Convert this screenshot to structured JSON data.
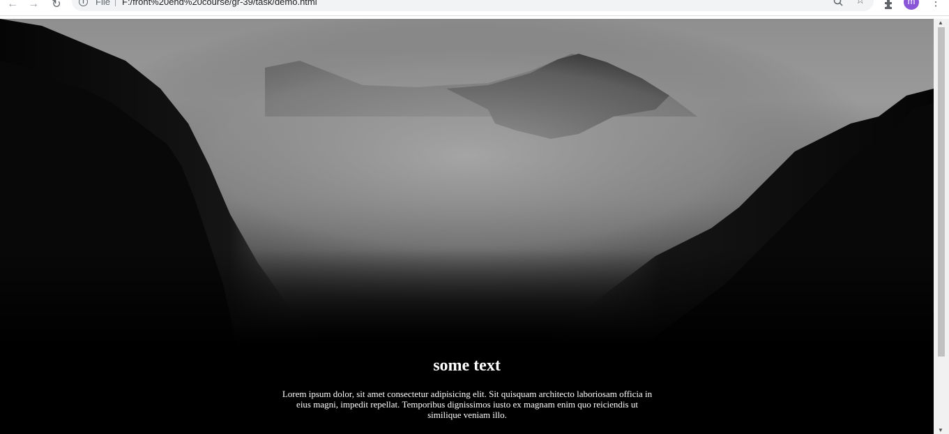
{
  "browser": {
    "scheme_label": "File",
    "url": "F:/front%20end%20course/gr-39/task/demo.html",
    "avatar_letter": "m"
  },
  "page": {
    "heading": "some text",
    "paragraph": "Lorem ipsum dolor, sit amet consectetur adipisicing elit. Sit quisquam architecto laboriosam officia in eius magni, impedit repellat. Temporibus dignissimos iusto ex magnam enim quo reiciendis ut similique veniam illo."
  },
  "colors": {
    "avatar_bg": "#8a56d8",
    "page_bg": "#000000",
    "text": "#ffffff"
  }
}
